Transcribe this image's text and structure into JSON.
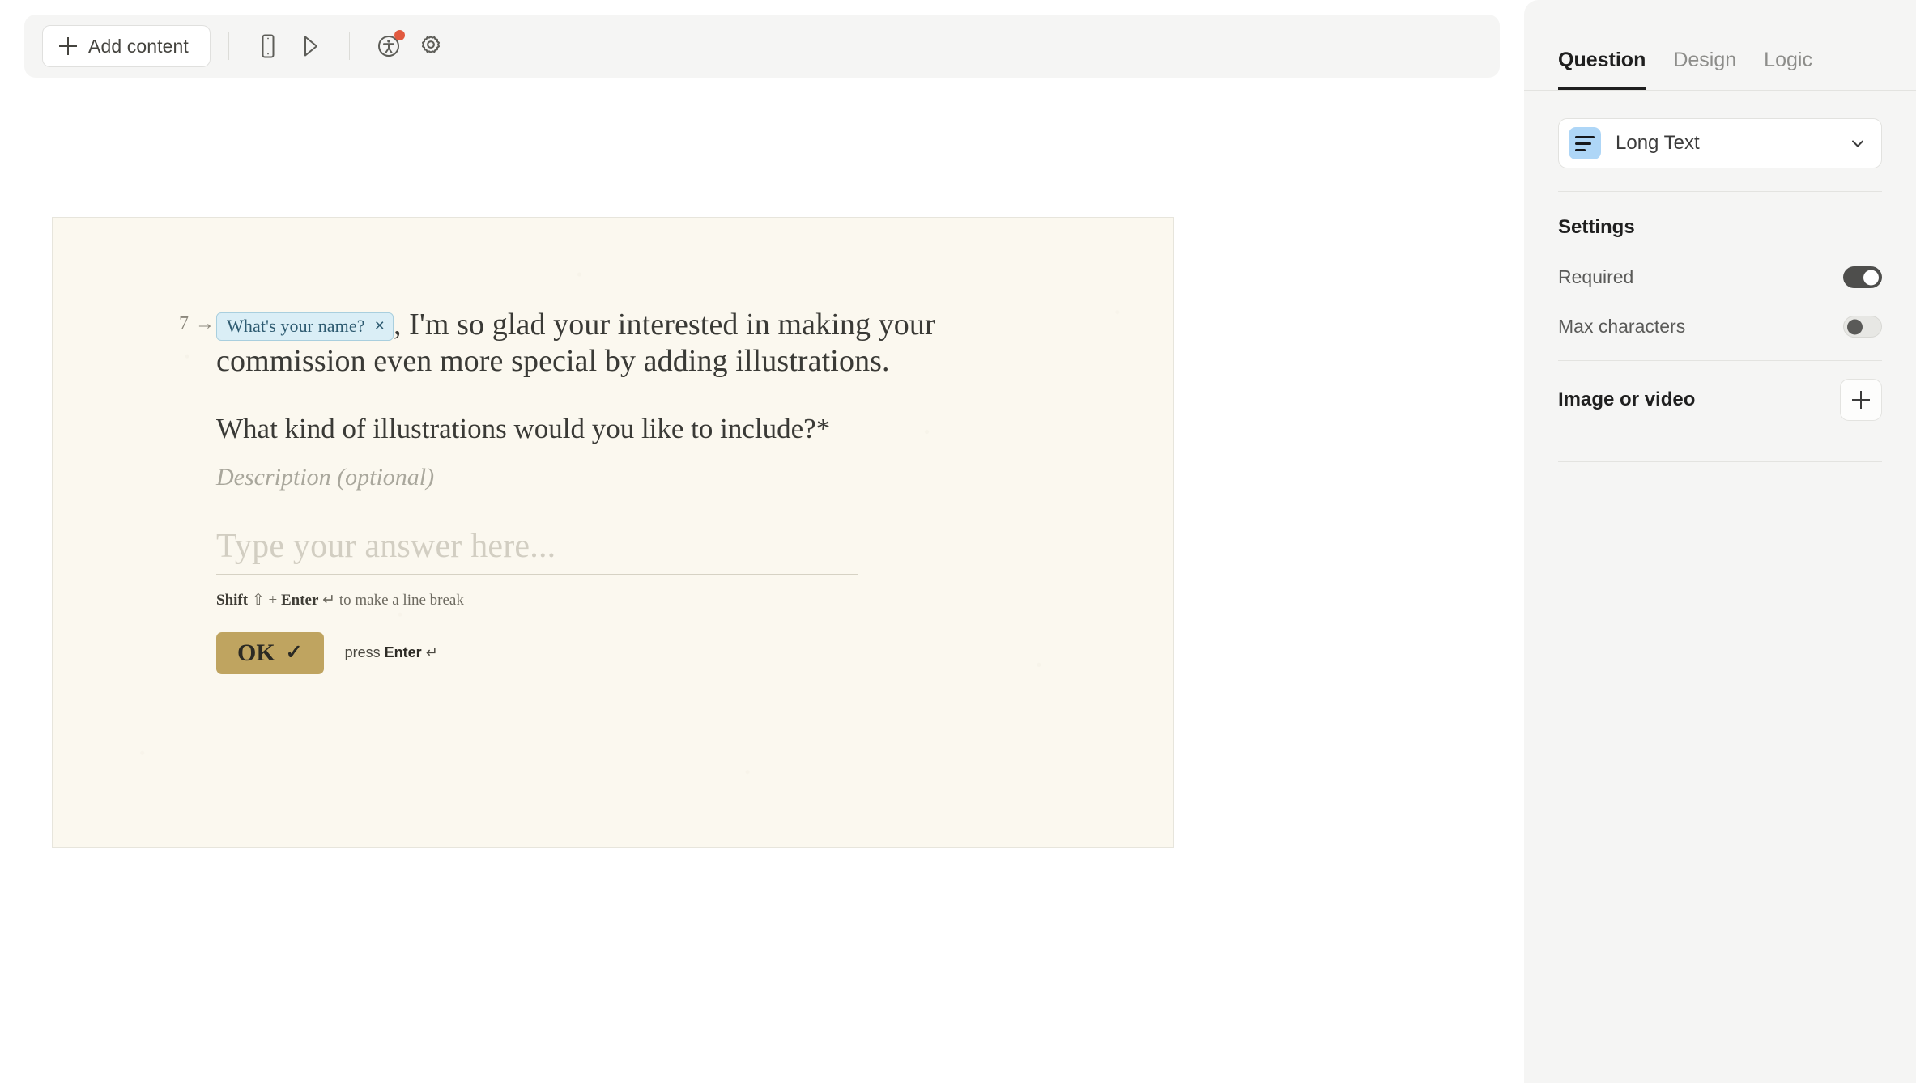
{
  "toolbar": {
    "add_content_label": "Add content",
    "icons": [
      {
        "name": "mobile-preview-icon",
        "title": "Mobile preview"
      },
      {
        "name": "play-preview-icon",
        "title": "Preview"
      },
      {
        "name": "accessibility-icon",
        "title": "Accessibility",
        "badge": true
      },
      {
        "name": "gear-icon",
        "title": "Settings"
      }
    ]
  },
  "canvas": {
    "question_number": "7 →",
    "recall_chip": {
      "label": "What's your name?",
      "close_glyph": "×"
    },
    "intro_text_after_chip": ", I'm so glad your interested in making your commission even more special by adding illustrations.",
    "question_title": "What kind of illustrations would you like to include?*",
    "description_placeholder": "Description (optional)",
    "answer_placeholder": "Type your answer here...",
    "hint": {
      "shift_label": "Shift",
      "shift_glyph": "⇧",
      "plus": "+",
      "enter_label": "Enter",
      "enter_glyph": "↵",
      "tail": "to make a line break"
    },
    "ok_button": {
      "label": "OK",
      "check_glyph": "✓"
    },
    "press_enter": {
      "prefix": "press",
      "key": "Enter",
      "glyph": "↵"
    }
  },
  "panel": {
    "tabs": [
      {
        "label": "Question",
        "active": true
      },
      {
        "label": "Design",
        "active": false
      },
      {
        "label": "Logic",
        "active": false
      }
    ],
    "question_type": "Long Text",
    "settings_title": "Settings",
    "settings": [
      {
        "label": "Required",
        "state": "on"
      },
      {
        "label": "Max characters",
        "state": "off"
      }
    ],
    "media": {
      "label": "Image or video",
      "add_glyph": "+"
    }
  },
  "colors": {
    "canvas_bg": "#fbf8ef",
    "ok_button": "#bfa460",
    "recall_chip_bg": "#daeef6",
    "recall_chip_text": "#2d5a70",
    "type_icon_bg": "#aed6f7",
    "notification_dot": "#e1593f",
    "panel_bg": "#f5f5f4",
    "toggle_on": "#4e4e4c"
  }
}
